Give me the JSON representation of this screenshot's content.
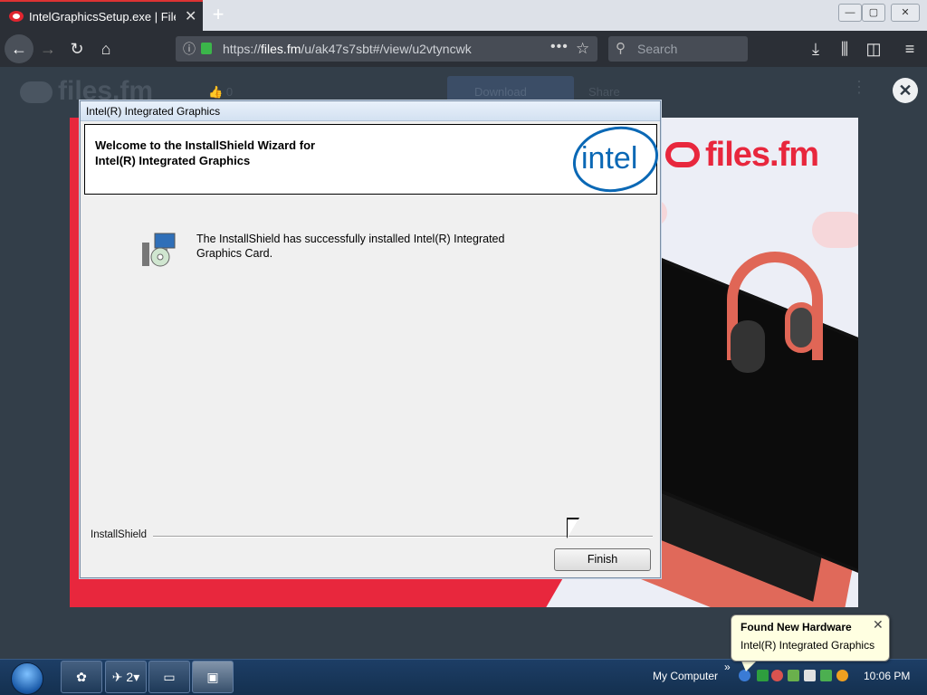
{
  "browser": {
    "tab_title": "IntelGraphicsSetup.exe | Files.fm",
    "tab_close": "✕",
    "new_tab": "+",
    "url_prefix": "https://",
    "url_domain": "files.fm",
    "url_path": "/u/ak47s7sbt#/view/u2vtyncwk",
    "search_placeholder": "Search",
    "window_buttons": [
      "—",
      "▢",
      "✕"
    ]
  },
  "page": {
    "logo": "files.fm",
    "likes": "0",
    "download_label": "Download",
    "share_label": "Share"
  },
  "ad": {
    "brand": "files.fm"
  },
  "dialog": {
    "title": "Intel(R) Integrated Graphics",
    "heading_line1": "Welcome to the InstallShield Wizard for",
    "heading_line2": "Intel(R) Integrated Graphics",
    "logo_text": "intel",
    "message_line1": "The InstallShield has successfully installed Intel(R) Integrated",
    "message_line2": "Graphics Card.",
    "footer_label": "InstallShield",
    "finish_label": "Finish"
  },
  "taskbar": {
    "items": [
      {
        "icon": "media-icon",
        "label": ""
      },
      {
        "icon": "folder-group-icon",
        "label": "2"
      },
      {
        "icon": "computer-icon",
        "label": ""
      },
      {
        "icon": "installer-icon",
        "label": ""
      }
    ],
    "toolbar_label": "My Computer",
    "chevron": "»",
    "clock": "10:06 PM"
  },
  "balloon": {
    "title": "Found New Hardware",
    "text": "Intel(R) Integrated Graphics",
    "close": "✕"
  },
  "colors": {
    "brand_red": "#e8273d",
    "intel_blue": "#0a68b5",
    "taskbar": "#1d3e66"
  }
}
